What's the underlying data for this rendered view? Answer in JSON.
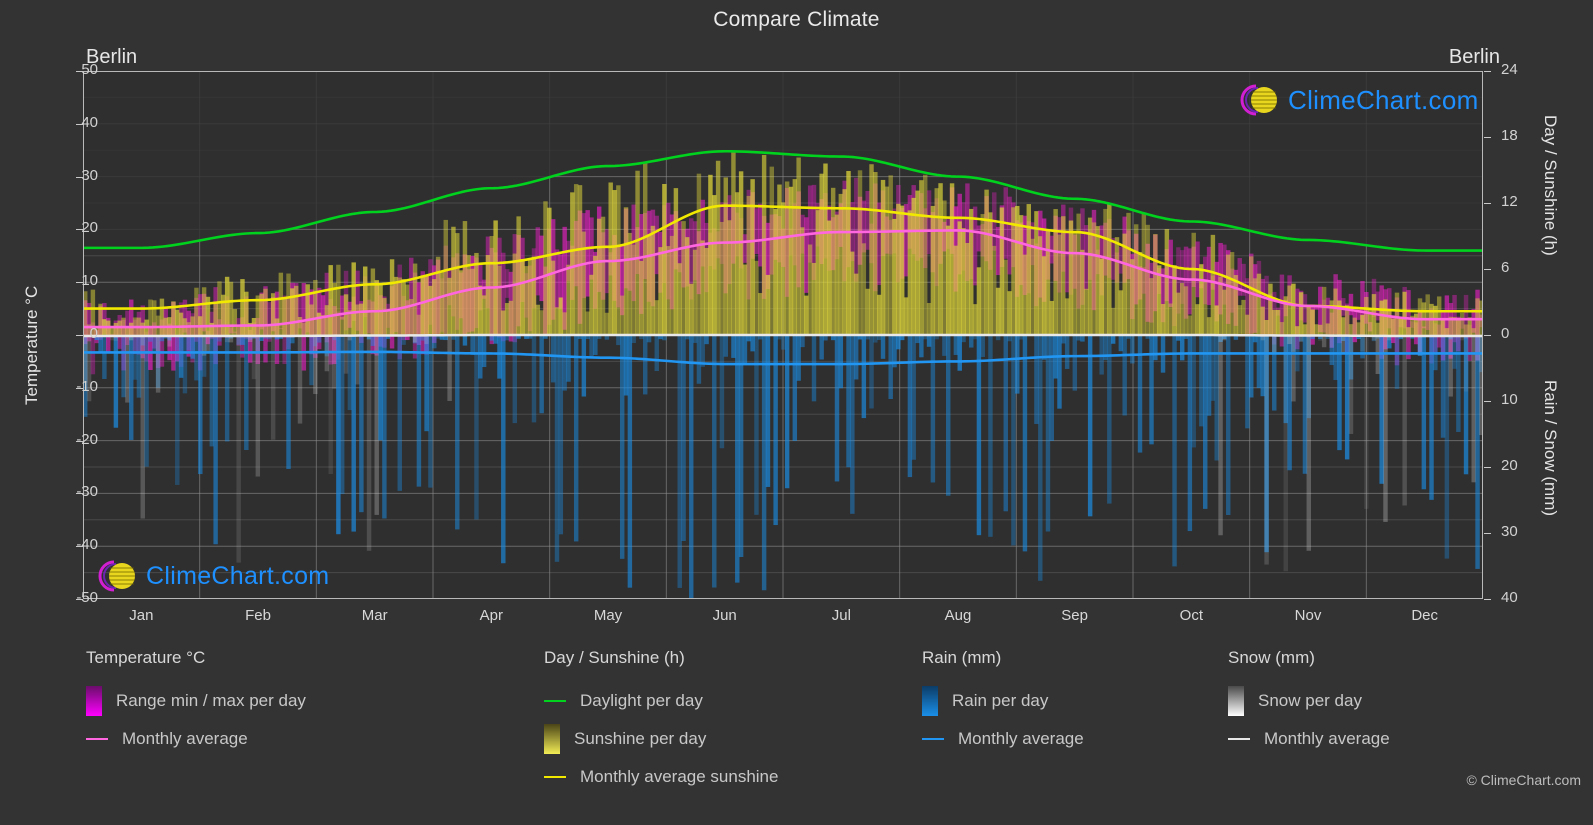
{
  "header": {
    "title": "Compare Climate",
    "city_left": "Berlin",
    "city_right": "Berlin"
  },
  "footer": {
    "copyright": "© ClimeChart.com"
  },
  "watermark": {
    "text": "ClimeChart.com",
    "arc_color": "#d11fd1",
    "sphere_color": "#e8d61e",
    "text_color": "#1e90ff"
  },
  "legend": {
    "groups": [
      {
        "title": "Temperature °C",
        "items": [
          {
            "label": "Range min / max per day",
            "marker": "gradient-box",
            "color": "#ff00ff",
            "color2": "#6a0d6a"
          },
          {
            "label": "Monthly average",
            "marker": "line",
            "color": "#ff66e0"
          }
        ]
      },
      {
        "title": "Day / Sunshine (h)",
        "items": [
          {
            "label": "Daylight per day",
            "marker": "line",
            "color": "#00d21e"
          },
          {
            "label": "Sunshine per day",
            "marker": "gradient-box",
            "color": "#f2ec55",
            "color2": "#4a4418"
          },
          {
            "label": "Monthly average sunshine",
            "marker": "line",
            "color": "#f2e900"
          }
        ]
      },
      {
        "title": "Rain (mm)",
        "items": [
          {
            "label": "Rain per day",
            "marker": "gradient-box",
            "color": "#1a8fe8",
            "color2": "#0b3c66"
          },
          {
            "label": "Monthly average",
            "marker": "line",
            "color": "#2196f3"
          }
        ]
      },
      {
        "title": "Snow (mm)",
        "items": [
          {
            "label": "Snow per day",
            "marker": "gradient-box",
            "color": "#ffffff",
            "color2": "#4a4a4a"
          },
          {
            "label": "Monthly average",
            "marker": "line",
            "color": "#e8e8e8"
          }
        ]
      }
    ]
  },
  "chart_data": {
    "type": "line",
    "title": "Compare Climate",
    "subtitle": "Berlin",
    "xlabel": "",
    "ylabel": "Temperature °C",
    "ylabel_right_top": "Day / Sunshine (h)",
    "ylabel_right_bottom": "Rain / Snow (mm)",
    "grid": true,
    "legend_position": "below",
    "background": "#333333",
    "plot_background": "#2f2f2f",
    "categories": [
      "Jan",
      "Feb",
      "Mar",
      "Apr",
      "May",
      "Jun",
      "Jul",
      "Aug",
      "Sep",
      "Oct",
      "Nov",
      "Dec"
    ],
    "x_tick_labels": [
      "Jan",
      "Feb",
      "Mar",
      "Apr",
      "May",
      "Jun",
      "Jul",
      "Aug",
      "Sep",
      "Oct",
      "Nov",
      "Dec"
    ],
    "ylim": [
      -50,
      50
    ],
    "y_ticks": [
      50,
      40,
      30,
      20,
      10,
      0,
      -10,
      -20,
      -30,
      -40,
      -50
    ],
    "y_ticks_right_top": [
      24,
      18,
      12,
      6,
      0
    ],
    "y_ticks_right_bottom": [
      0,
      10,
      20,
      30,
      40
    ],
    "right_axis_hours_per_degree": 0.48,
    "right_axis_mm_per_degree": 0.8,
    "series": [
      {
        "name": "Daylight per day",
        "unit": "h",
        "axis": "right-top",
        "color": "#00d21e",
        "values_hours": [
          8.0,
          9.3,
          11.2,
          13.3,
          15.3,
          16.7,
          16.2,
          14.4,
          12.4,
          10.3,
          8.6,
          7.7
        ],
        "values_plot_deg": [
          16.5,
          19.3,
          23.3,
          27.8,
          32.0,
          34.8,
          33.8,
          30.0,
          25.8,
          21.5,
          18.0,
          16.0
        ]
      },
      {
        "name": "Monthly average sunshine",
        "unit": "h",
        "axis": "right-top",
        "color": "#f2e900",
        "values_hours": [
          2.4,
          3.2,
          4.6,
          6.5,
          8.0,
          8.5,
          8.4,
          7.9,
          6.2,
          4.1,
          2.3,
          1.9
        ],
        "values_plot_deg": [
          5.0,
          6.6,
          9.6,
          13.6,
          16.7,
          24.5,
          24.0,
          22.2,
          19.5,
          12.5,
          5.5,
          4.5
        ]
      },
      {
        "name": "Temperature monthly average",
        "unit": "°C",
        "axis": "left",
        "color": "#ff66e0",
        "values": [
          1.5,
          1.8,
          4.5,
          9.0,
          14.0,
          17.5,
          19.5,
          19.8,
          15.5,
          10.5,
          5.5,
          3.0
        ]
      },
      {
        "name": "Rain monthly average",
        "unit": "mm",
        "axis": "right-bottom",
        "color": "#2196f3",
        "values_mm": [
          1.3,
          1.3,
          1.3,
          1.4,
          1.7,
          2.2,
          2.2,
          2.0,
          1.6,
          1.4,
          1.4,
          1.4
        ],
        "values_plot_deg": [
          -3.3,
          -3.3,
          -3.2,
          -3.5,
          -4.3,
          -5.5,
          -5.5,
          -5.0,
          -4.0,
          -3.5,
          -3.5,
          -3.5
        ]
      },
      {
        "name": "Snow monthly average",
        "unit": "mm",
        "axis": "right-bottom",
        "color": "#e8e8e8",
        "values_mm": [
          0.1,
          0.1,
          0.05,
          0.0,
          0.0,
          0.0,
          0.0,
          0.0,
          0.0,
          0.0,
          0.05,
          0.1
        ],
        "values_plot_deg": [
          -0.2,
          -0.2,
          -0.1,
          0.0,
          0.0,
          0.0,
          0.0,
          0.0,
          0.0,
          0.0,
          -0.1,
          -0.2
        ]
      }
    ],
    "daily_bands": [
      {
        "name": "Range min / max per day",
        "color": "#ff00ff",
        "axis": "left",
        "note": "magenta vertical daily temperature range bars"
      },
      {
        "name": "Sunshine per day",
        "color": "#e8e03c",
        "axis": "right-top",
        "note": "yellow vertical daily sunshine bars"
      },
      {
        "name": "Rain per day",
        "color": "#1a8fe8",
        "axis": "right-bottom",
        "note": "blue downward daily rain bars"
      },
      {
        "name": "Snow per day",
        "color": "#cccccc",
        "axis": "right-bottom",
        "note": "grey downward daily snow bars"
      }
    ]
  }
}
